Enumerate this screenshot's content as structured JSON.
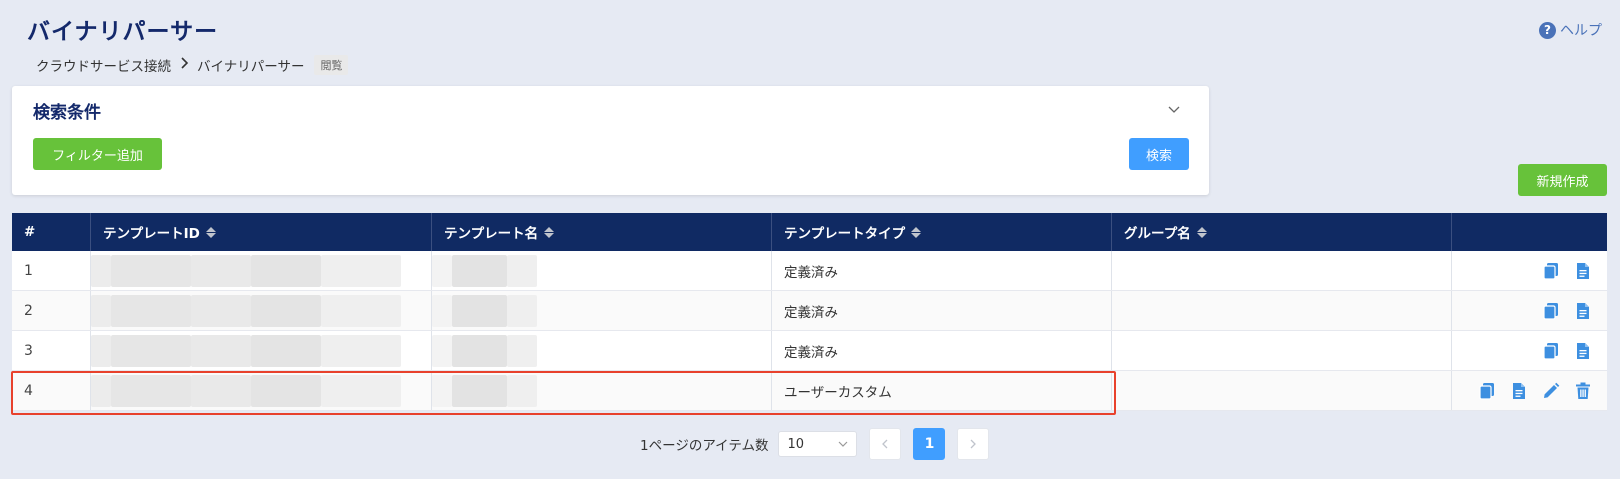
{
  "page": {
    "title": "バイナリパーサー",
    "help_label": "ヘルプ",
    "help_icon": "question-circle-icon"
  },
  "breadcrumb": {
    "items": [
      "クラウドサービス接続",
      "バイナリパーサー"
    ],
    "separator": ">",
    "badge": "閲覧"
  },
  "search": {
    "title": "検索条件",
    "filter_button": "フィルター追加",
    "search_button": "検索"
  },
  "toolbar": {
    "new_button": "新規作成"
  },
  "table": {
    "columns": [
      "#",
      "テンプレートID",
      "テンプレート名",
      "テンプレートタイプ",
      "グループ名",
      ""
    ],
    "rows": [
      {
        "index": "1",
        "template_id": "",
        "template_name": "",
        "template_type": "定義済み",
        "group": "",
        "actions": [
          "copy",
          "view"
        ]
      },
      {
        "index": "2",
        "template_id": "",
        "template_name": "",
        "template_type": "定義済み",
        "group": "",
        "actions": [
          "copy",
          "view"
        ]
      },
      {
        "index": "3",
        "template_id": "",
        "template_name": "",
        "template_type": "定義済み",
        "group": "",
        "actions": [
          "copy",
          "view"
        ]
      },
      {
        "index": "4",
        "template_id": "",
        "template_name": "",
        "template_type": "ユーザーカスタム",
        "group": "",
        "actions": [
          "copy",
          "view",
          "edit",
          "delete"
        ]
      }
    ]
  },
  "pagination": {
    "items_per_page_label": "1ページのアイテム数",
    "page_size": "10",
    "current_page": "1",
    "prev": "<",
    "next": ">"
  },
  "colors": {
    "header_bg": "#102a63",
    "title": "#14296b",
    "primary": "#409eff",
    "success": "#67c23a",
    "highlight": "#e8412c",
    "background": "#e6eaf3"
  }
}
